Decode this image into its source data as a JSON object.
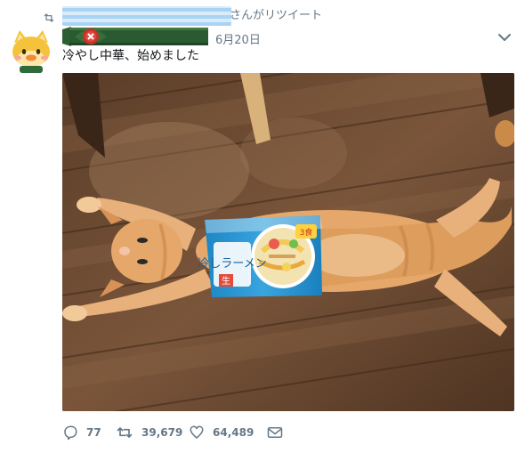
{
  "retweet": {
    "label": "さんがリツイート",
    "icon": "retweet-icon"
  },
  "tweet": {
    "date": "6月20日",
    "text": "冷やし中華、始めました",
    "image": {
      "package_text": "冷しラーメン",
      "package_tag": "生",
      "package_badge": "3食"
    }
  },
  "actions": {
    "reply_count": "77",
    "retweet_count": "39,679",
    "like_count": "64,489"
  },
  "colors": {
    "muted": "#657786",
    "text": "#14171a"
  }
}
